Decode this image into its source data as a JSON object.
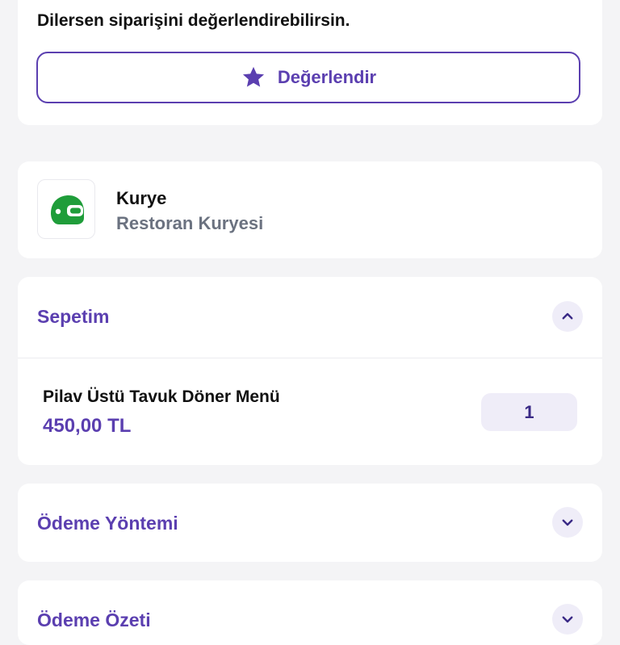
{
  "rating": {
    "prompt": "Dilersen siparişini değerlendirebilirsin.",
    "button_label": "Değerlendir",
    "icon": "star-icon"
  },
  "courier": {
    "title": "Kurye",
    "subtitle": "Restoran Kuryesi",
    "icon": "courier-helmet-icon",
    "icon_color": "#1f9d3a"
  },
  "cart": {
    "title": "Sepetim",
    "expanded": true,
    "items": [
      {
        "name": "Pilav Üstü Tavuk Döner Menü",
        "price": "450,00 TL",
        "quantity": "1"
      }
    ]
  },
  "payment_method": {
    "title": "Ödeme Yöntemi",
    "expanded": false
  },
  "payment_summary": {
    "title": "Ödeme Özeti",
    "expanded": false
  },
  "colors": {
    "accent": "#5b3fb0",
    "background": "#f4f4f6",
    "card": "#ffffff",
    "chip": "#efedf8"
  }
}
